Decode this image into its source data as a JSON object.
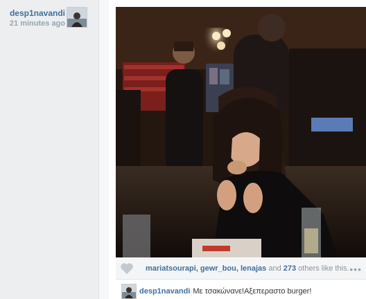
{
  "post": {
    "author": "desp1navandi",
    "time": "21 minutes ago"
  },
  "likes": {
    "users": [
      "mariatsourapi",
      "gewr_bou",
      "lenajas"
    ],
    "and_text": "and",
    "count": "273",
    "suffix": "others like this."
  },
  "actions": {
    "heart_icon": "heart-icon",
    "more_icon": "ellipsis-icon",
    "more_label": "•••"
  },
  "comment": {
    "user": "desp1navandi",
    "text": "Με τσακώνανε!Αξεπεραστο burger!"
  },
  "colors": {
    "link": "#3f6f9f",
    "meta": "#9aa3ad"
  }
}
